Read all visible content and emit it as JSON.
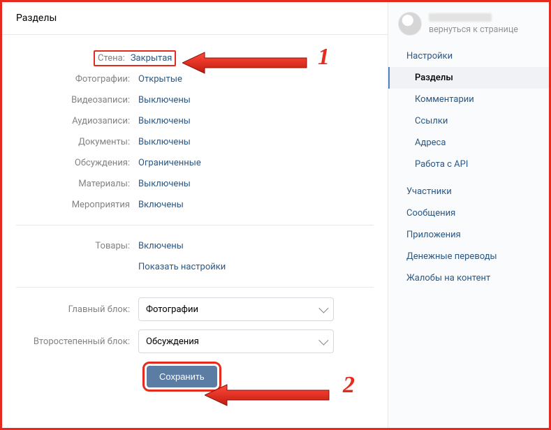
{
  "header": {
    "title": "Разделы"
  },
  "sections": {
    "wall": {
      "label": "Стена:",
      "value": "Закрытая"
    },
    "photos": {
      "label": "Фотографии:",
      "value": "Открытые"
    },
    "videos": {
      "label": "Видеозаписи:",
      "value": "Выключены"
    },
    "audio": {
      "label": "Аудиозаписи:",
      "value": "Выключены"
    },
    "docs": {
      "label": "Документы:",
      "value": "Выключены"
    },
    "discuss": {
      "label": "Обсуждения:",
      "value": "Ограниченные"
    },
    "materials": {
      "label": "Материалы:",
      "value": "Выключены"
    },
    "events": {
      "label": "Мероприятия",
      "value": "Включены"
    },
    "goods": {
      "label": "Товары:",
      "value": "Включены"
    },
    "goods_settings_link": "Показать настройки"
  },
  "blocks": {
    "main": {
      "label": "Главный блок:",
      "value": "Фотографии"
    },
    "secondary": {
      "label": "Второстепенный блок:",
      "value": "Обсуждения"
    }
  },
  "save_label": "Сохранить",
  "sidebar": {
    "back_link": "вернуться к странице",
    "items": [
      {
        "label": "Настройки",
        "kind": "top"
      },
      {
        "label": "Разделы",
        "kind": "sub",
        "active": true
      },
      {
        "label": "Комментарии",
        "kind": "sub"
      },
      {
        "label": "Ссылки",
        "kind": "sub"
      },
      {
        "label": "Адреса",
        "kind": "sub"
      },
      {
        "label": "Работа с API",
        "kind": "sub"
      },
      {
        "label": "Участники",
        "kind": "top"
      },
      {
        "label": "Сообщения",
        "kind": "top"
      },
      {
        "label": "Приложения",
        "kind": "top"
      },
      {
        "label": "Денежные переводы",
        "kind": "top"
      },
      {
        "label": "Жалобы на контент",
        "kind": "top"
      }
    ]
  },
  "annotations": {
    "n1": "1",
    "n2": "2"
  }
}
